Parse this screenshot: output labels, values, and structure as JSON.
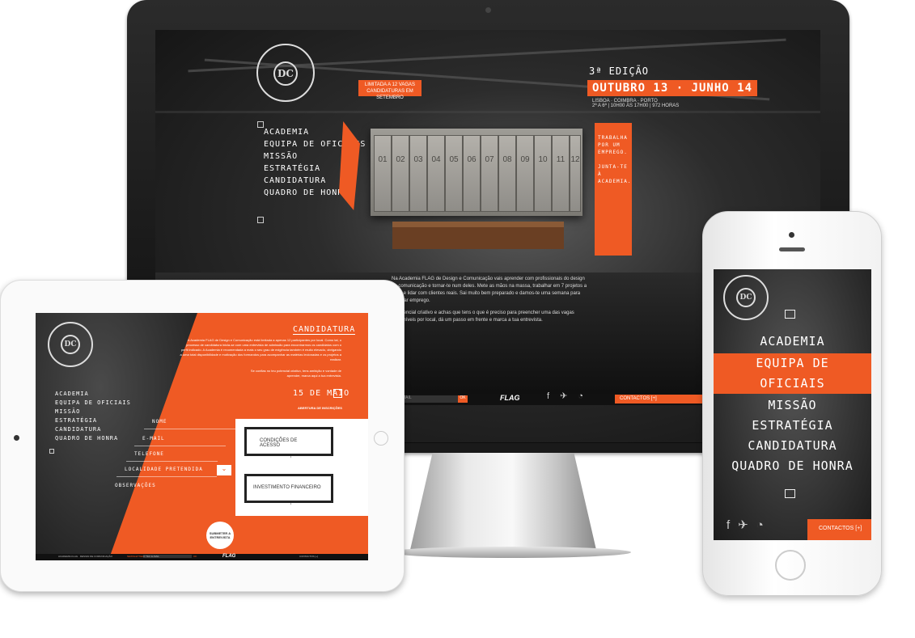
{
  "desktop": {
    "logo": {
      "ring_text": "ACADEMIA FLAG · DESIGN DE COMUNICAÇÃO",
      "monogram": "DC"
    },
    "badge": {
      "line1": "LIMITADA A 12 VAGAS",
      "line2": "CANDIDATURAS EM SETEMBRO"
    },
    "edition": "3ª EDIÇÃO",
    "dates": "OUTUBRO 13 · JUNHO 14",
    "location": "LISBOA · COIMBRA · PORTO",
    "schedule": "2ª A 6ª | 10H00 ÀS 17H00 | 972 HORAS",
    "nav": [
      "Academia",
      "Equipa de Oficiais",
      "Missão",
      "Estratégia",
      "Candidatura",
      "Quadro de Honra"
    ],
    "lockers": [
      "01",
      "02",
      "03",
      "04",
      "05",
      "06",
      "07",
      "08",
      "09",
      "10",
      "11",
      "12"
    ],
    "banner": [
      "TRABALHA",
      "POR UM",
      "EMPREGO.",
      "",
      "JUNTA-TE",
      "À ACADEMIA."
    ],
    "text": {
      "p1": "Na Academia FLAG de Design e Comunicação vais aprender com profissionais do design de comunicação e tornar-te num deles. Mete as mãos na massa, trabalhar em 7 projetos a sério e lidar com clientes reais. Sai muito bem preparado e damos-te uma semana para arranjar emprego.",
      "p2": "O potencial criativo e achas que tens o que é preciso para preencher uma das vagas disponíveis por local, dá um passo em frente e marca a tua entrevista."
    },
    "footer": {
      "newsletter_placeholder": "E-MAIL",
      "ok": "OK",
      "brand": "FLAG",
      "social_icons": [
        "facebook-icon",
        "twitter-icon",
        "chat-icon"
      ],
      "contact": "CONTACTOS [+]"
    }
  },
  "tablet": {
    "logo_monogram": "DC",
    "nav": [
      "Academia",
      "Equipa de Oficiais",
      "Missão",
      "Estratégia",
      "Candidatura",
      "Quadro de Honra"
    ],
    "title": "CANDIDATURA",
    "intro": "A Academia FLAG de Design e Comunicação está limitada a apenas 12 participantes por local. Como tal, o processo de candidatura inicia-se com uma entrevista de admissão para encontrarmos os candidatos com o perfil indicado. A Academia é recomendada a mais o seu grau de exigência também é muito elevado, obrigando a uma total disponibilidade e motivação dos formandos para acompanhar as matérias lecionadas e os projetos a realizar.",
    "intro2": "Se confias no teu potencial criativo, tens ambição e vontade de aprender, marca aqui a tua entrevista.",
    "date": "15 DE MAIO",
    "date_sub": "ABERTURA DE INSCRIÇÕES",
    "fields": [
      "NOME",
      "E-MAIL",
      "TELEFONE",
      "LOCALIDADE PRETENDIDA",
      "OBSERVAÇÕES"
    ],
    "box1": "CONDIÇÕES DE ACESSO",
    "box2": "INVESTIMENTO FINANCEIRO",
    "submit": "SUBMETER A ENTREVISTA",
    "footer": [
      "ACADEMIA FLAG · DESIGN DE COMUNICAÇÃO",
      "NEWSLETTER",
      "O TEU E-MAIL",
      "OK",
      "FLAG",
      "CONTACTOS [+]"
    ]
  },
  "phone": {
    "logo_monogram": "DC",
    "nav": [
      "Academia",
      "Equipa de Oficiais",
      "Missão",
      "Estratégia",
      "Candidatura",
      "Quadro de Honra"
    ],
    "active_index": 1,
    "contact": "CONTACTOS [+]",
    "social_glyphs": "f ✈ ◔"
  },
  "colors": {
    "accent": "#ef5a24",
    "dark": "#1b1b1b"
  }
}
